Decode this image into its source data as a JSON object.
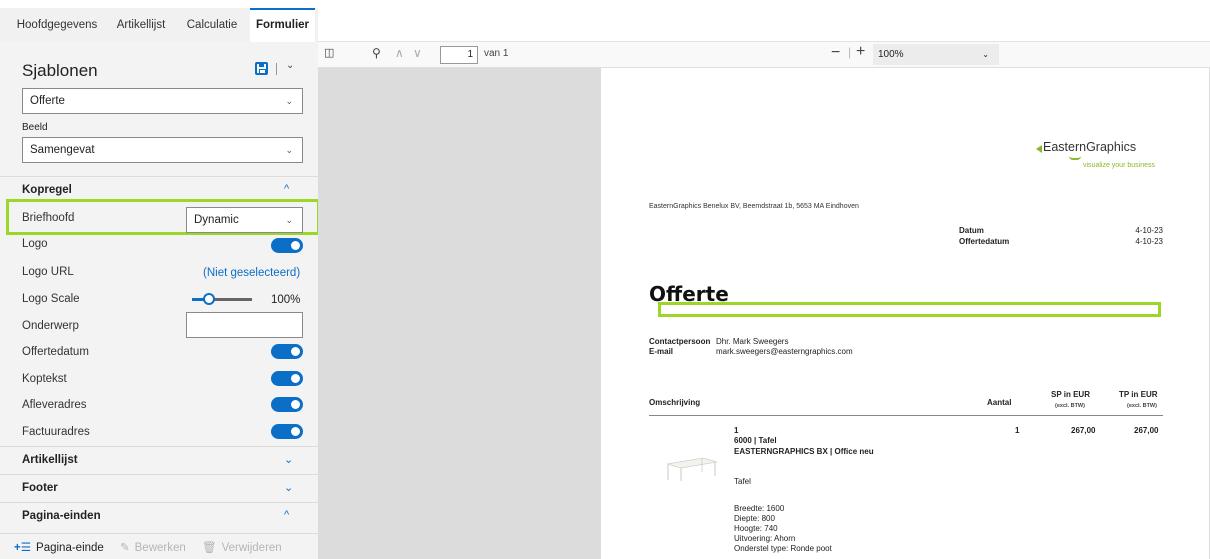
{
  "tabs": [
    {
      "label": "Hoofdgegevens"
    },
    {
      "label": "Artikellijst"
    },
    {
      "label": "Calculatie"
    },
    {
      "label": "Formulier"
    }
  ],
  "sidebar": {
    "title": "Sjablonen",
    "template_select": "Offerte",
    "view_label": "Beeld",
    "view_select": "Samengevat",
    "section_kopregel": "Kopregel",
    "briefhoofd": {
      "label": "Briefhoofd",
      "value": "Dynamic"
    },
    "logo": {
      "label": "Logo",
      "on": true
    },
    "logo_url": {
      "label": "Logo URL",
      "value": "(Niet geselecteerd)"
    },
    "logo_scale": {
      "label": "Logo Scale",
      "value": "100%",
      "level": 0.2
    },
    "onderwerp": {
      "label": "Onderwerp",
      "value": ""
    },
    "offertedatum": {
      "label": "Offertedatum",
      "on": true
    },
    "koptekst": {
      "label": "Koptekst",
      "on": true
    },
    "afleveradres": {
      "label": "Afleveradres",
      "on": true
    },
    "factuuradres": {
      "label": "Factuuradres",
      "on": true
    },
    "section_artikellijst": "Artikellijst",
    "section_footer": "Footer",
    "section_pagina": "Pagina-einden",
    "bottom": {
      "add": "Pagina-einde",
      "edit": "Bewerken",
      "delete": "Verwijderen"
    }
  },
  "viewer": {
    "page_current": "1",
    "page_total": "van 1",
    "zoom": "100%"
  },
  "document": {
    "logo_text": "EasternGraphics",
    "logo_tagline": "visualize your business",
    "address": "EasternGraphics Benelux BV, Beemdstraat 1b, 5653 MA Eindhoven",
    "meta": [
      {
        "label": "Datum",
        "value": "4-10-23"
      },
      {
        "label": "Offertedatum",
        "value": "4-10-23"
      }
    ],
    "title": "Offerte",
    "contact": [
      {
        "label": "Contactpersoon",
        "value": "Dhr. Mark Sweegers"
      },
      {
        "label": "E-mail",
        "value": "mark.sweegers@easterngraphics.com"
      }
    ],
    "columns": {
      "description": "Omschrijving",
      "quantity": "Aantal",
      "sp": "SP in EUR",
      "sp_sub": "(excl. BTW)",
      "tp": "TP in EUR",
      "tp_sub": "(excl. BTW)"
    },
    "item": {
      "pos": "1",
      "name": "6000 | Tafel",
      "brand": "EASTERNGRAPHICS BX | Office neu",
      "type": "Tafel",
      "specs": [
        "Breedte: 1600",
        "Diepte: 800",
        "Hoogte: 740",
        "Uitvoering: Ahorn",
        "Onderstel type: Ronde poot"
      ],
      "qty": "1",
      "sp": "267,00",
      "tp": "267,00"
    }
  },
  "colors": {
    "accent": "#0b6ec7",
    "highlight": "#9cd626"
  }
}
